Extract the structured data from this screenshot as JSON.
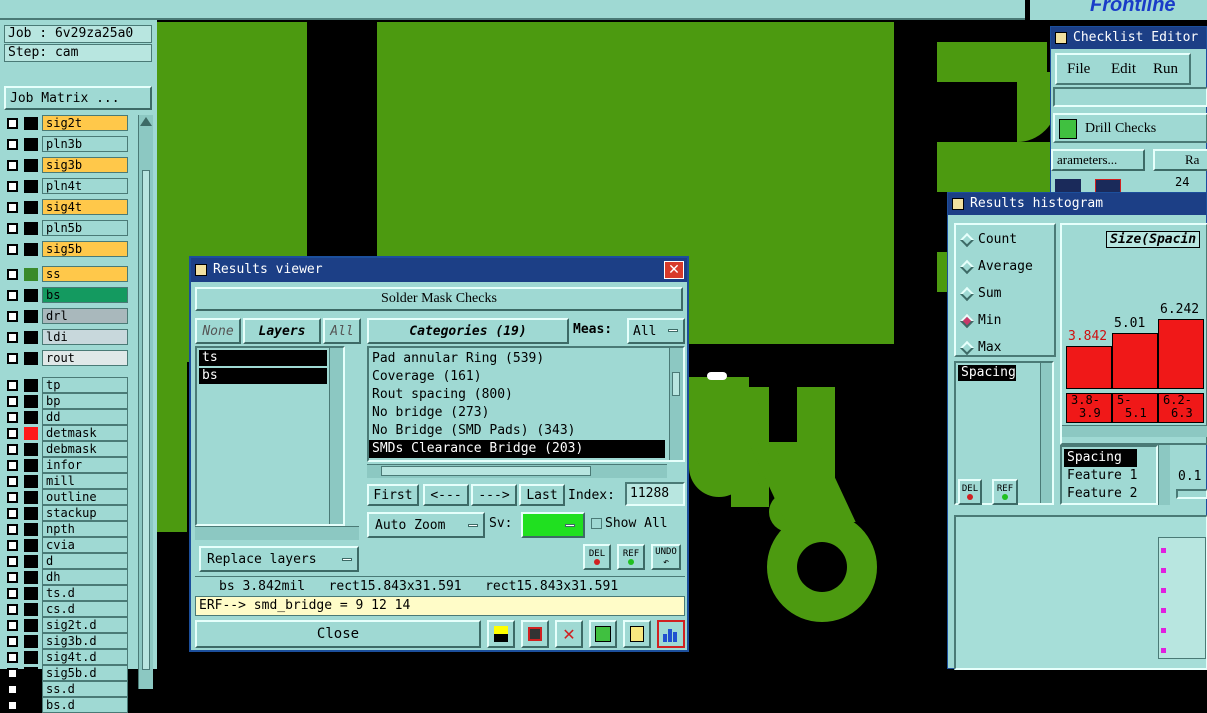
{
  "topbar": {
    "brand": "Frontline"
  },
  "left_panel": {
    "job": "Job : 6v29za25a0",
    "step": "Step: cam",
    "job_matrix_label": "Job Matrix ...",
    "layers": [
      {
        "name": "sig2t",
        "swatch": "#000000",
        "color": "#ffc84a"
      },
      {
        "name": "pln3b",
        "swatch": "#000000",
        "color": "#9fd9d3"
      },
      {
        "name": "sig3b",
        "swatch": "#000000",
        "color": "#ffc84a"
      },
      {
        "name": "pln4t",
        "swatch": "#000000",
        "color": "#9fd9d3"
      },
      {
        "name": "sig4t",
        "swatch": "#000000",
        "color": "#ffc84a"
      },
      {
        "name": "pln5b",
        "swatch": "#000000",
        "color": "#9fd9d3"
      },
      {
        "name": "sig5b",
        "swatch": "#000000",
        "color": "#ffc84a"
      },
      {
        "name": "ss",
        "swatch": "#3a8a2a",
        "color": "#ffc84a"
      },
      {
        "name": "bs",
        "swatch": "#000000",
        "color": "#149a60"
      },
      {
        "name": "drl",
        "swatch": "#000000",
        "color": "#a9b8bc"
      },
      {
        "name": "ldi",
        "swatch": "#000000",
        "color": "#c8d8dc"
      },
      {
        "name": "rout",
        "swatch": "#000000",
        "color": "#e0e8e8"
      },
      {
        "name": "tp",
        "swatch": "#000000",
        "color": "#9fd9d3"
      },
      {
        "name": "bp",
        "swatch": "#000000",
        "color": "#9fd9d3"
      },
      {
        "name": "dd",
        "swatch": "#000000",
        "color": "#9fd9d3"
      },
      {
        "name": "detmask",
        "swatch": "#ff1a1a",
        "color": "#9fd9d3"
      },
      {
        "name": "debmask",
        "swatch": "#000000",
        "color": "#9fd9d3"
      },
      {
        "name": "infor",
        "swatch": "#000000",
        "color": "#9fd9d3"
      },
      {
        "name": "mill",
        "swatch": "#000000",
        "color": "#9fd9d3"
      },
      {
        "name": "outline",
        "swatch": "#000000",
        "color": "#9fd9d3"
      },
      {
        "name": "stackup",
        "swatch": "#000000",
        "color": "#9fd9d3"
      },
      {
        "name": "npth",
        "swatch": "#000000",
        "color": "#9fd9d3"
      },
      {
        "name": "cvia",
        "swatch": "#000000",
        "color": "#9fd9d3"
      },
      {
        "name": "d",
        "swatch": "#000000",
        "color": "#9fd9d3"
      },
      {
        "name": "dh",
        "swatch": "#000000",
        "color": "#9fd9d3"
      },
      {
        "name": "ts.d",
        "swatch": "#000000",
        "color": "#9fd9d3"
      },
      {
        "name": "cs.d",
        "swatch": "#000000",
        "color": "#9fd9d3"
      },
      {
        "name": "sig2t.d",
        "swatch": "#000000",
        "color": "#9fd9d3"
      },
      {
        "name": "sig3b.d",
        "swatch": "#000000",
        "color": "#9fd9d3"
      },
      {
        "name": "sig4t.d",
        "swatch": "#000000",
        "color": "#9fd9d3"
      },
      {
        "name": "sig5b.d",
        "swatch": "#000000",
        "color": "#9fd9d3"
      },
      {
        "name": "ss.d",
        "swatch": "#000000",
        "color": "#9fd9d3"
      },
      {
        "name": "bs.d",
        "swatch": "#000000",
        "color": "#9fd9d3"
      }
    ]
  },
  "results_viewer": {
    "title": "Results viewer",
    "close_x": "✕",
    "header": "Solder Mask Checks",
    "none_btn": "None",
    "layers_btn": "Layers",
    "all_btn": "All",
    "categories_btn": "Categories (19)",
    "meas_label": "Meas:",
    "meas_value": "All",
    "layer_items": [
      "ts",
      "bs"
    ],
    "categories": [
      "Pad annular Ring (539)",
      "Coverage (161)",
      "Rout spacing (800)",
      "No bridge (273)",
      "No Bridge (SMD Pads) (343)",
      "SMDs Clearance Bridge (203)"
    ],
    "selected_category": 5,
    "first_btn": "First",
    "prev_btn": "<---",
    "next_btn": "--->",
    "last_btn": "Last",
    "index_label": "Index:",
    "index_value": "11288",
    "auto_zoom": "Auto Zoom",
    "sv_label": "Sv:",
    "show_all": "Show All",
    "replace_layers": "Replace layers",
    "del": "DEL",
    "ref": "REF",
    "undo": "UNDO",
    "status": "bs 3.842mil   rect15.843x31.591   rect15.843x31.591",
    "erf": "ERF--> smd_bridge = 9 12 14",
    "close_btn": "Close"
  },
  "checklist_editor": {
    "title": "Checklist Editor",
    "menu": [
      "File",
      "Edit",
      "Run"
    ],
    "drill_checks": "Drill Checks",
    "parameters": "arameters...",
    "run_partial": "Ra",
    "count_partial": "24"
  },
  "results_histogram": {
    "title": "Results histogram",
    "modes": [
      "Count",
      "Average",
      "Sum",
      "Min",
      "Max"
    ],
    "selected_mode": "Min",
    "size_label": "Size(Spacin",
    "list1": [
      "Spacing"
    ],
    "list2": [
      "Spacing",
      "Feature 1",
      "Feature 2"
    ],
    "value_partial": "0.1",
    "del": "DEL",
    "ref": "REF"
  },
  "chart_data": {
    "type": "bar",
    "categories": [
      "3.8-3.9",
      "5-5.1",
      "6.2-6.3"
    ],
    "values": [
      3.842,
      5.01,
      6.242
    ],
    "value_labels": [
      "3.842",
      "5.01",
      "6.242"
    ],
    "category_labels": [
      [
        "3.8-",
        "3.9"
      ],
      [
        "5-",
        "5.1"
      ],
      [
        "6.2-",
        "6.3"
      ]
    ],
    "title": "Size(Spacin",
    "ylim": [
      0,
      6.242
    ]
  }
}
